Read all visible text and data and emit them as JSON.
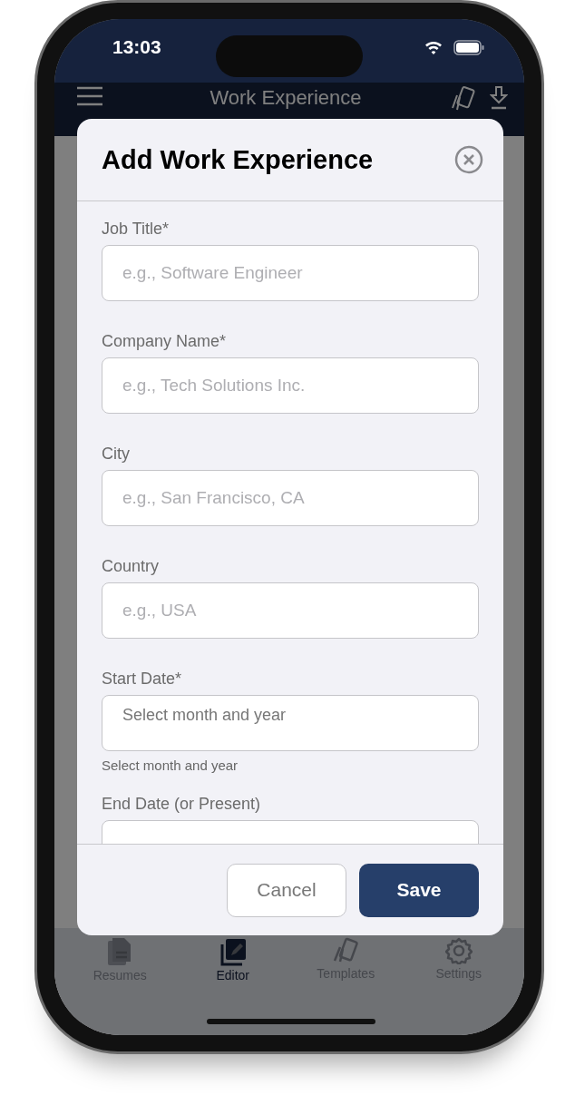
{
  "status_bar": {
    "time": "13:03"
  },
  "header": {
    "title": "Work Experience"
  },
  "dialog": {
    "title": "Add Work Experience",
    "fields": [
      {
        "label": "Job Title*",
        "placeholder": "e.g., Software Engineer"
      },
      {
        "label": "Company Name*",
        "placeholder": "e.g., Tech Solutions Inc."
      },
      {
        "label": "City",
        "placeholder": "e.g., San Francisco, CA"
      },
      {
        "label": "Country",
        "placeholder": "e.g., USA"
      },
      {
        "label": "Start Date*",
        "placeholder": "Select month and year",
        "kind": "date",
        "hint": "Select month and year"
      },
      {
        "label": "End Date (or Present)",
        "kind": "date"
      }
    ],
    "buttons": [
      {
        "label": "Cancel",
        "kind": "secondary"
      },
      {
        "label": "Save",
        "kind": "primary"
      }
    ]
  },
  "tab_bar": [
    {
      "label": "Resumes",
      "selected": false
    },
    {
      "label": "Editor",
      "selected": true
    },
    {
      "label": "Templates",
      "selected": false
    },
    {
      "label": "Settings",
      "selected": false
    }
  ]
}
